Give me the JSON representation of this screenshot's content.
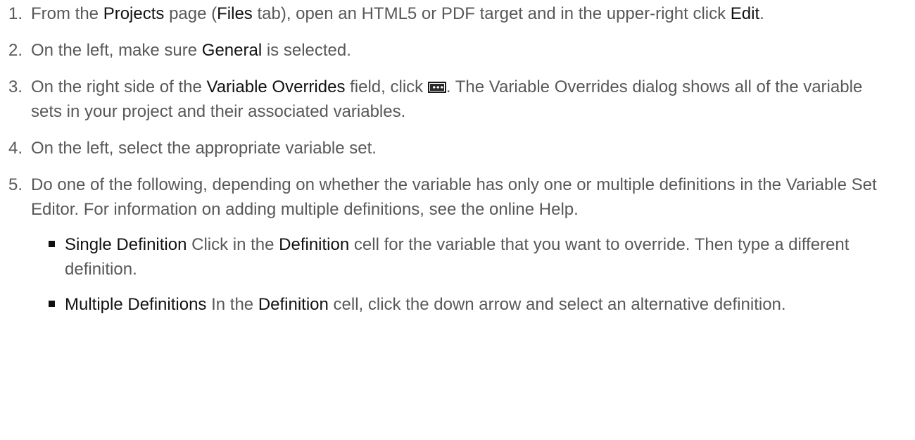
{
  "steps": [
    {
      "number": "1.",
      "parts": [
        {
          "t": "From the ",
          "b": false
        },
        {
          "t": "Projects",
          "b": true
        },
        {
          "t": " page (",
          "b": false
        },
        {
          "t": "Files",
          "b": true
        },
        {
          "t": " tab), open an HTML5 or PDF target and in the upper-right click ",
          "b": false
        },
        {
          "t": "Edit",
          "b": true
        },
        {
          "t": ".",
          "b": false
        }
      ]
    },
    {
      "number": "2.",
      "parts": [
        {
          "t": "On the left, make sure ",
          "b": false
        },
        {
          "t": "General",
          "b": true
        },
        {
          "t": " is selected.",
          "b": false
        }
      ]
    },
    {
      "number": "3.",
      "parts": [
        {
          "t": "On the right side of the ",
          "b": false
        },
        {
          "t": "Variable Overrides",
          "b": true
        },
        {
          "t": " field, click ",
          "b": false
        },
        {
          "icon": "ellipsis-button-icon"
        },
        {
          "t": ". The Variable Overrides dialog shows all of the variable sets in your project and their associated variables.",
          "b": false
        }
      ]
    },
    {
      "number": "4.",
      "parts": [
        {
          "t": "On the left, select the appropriate variable set.",
          "b": false
        }
      ]
    },
    {
      "number": "5.",
      "parts": [
        {
          "t": "Do one of the following, depending on whether the variable has only one or multiple definitions in the Variable Set Editor. For information on adding multiple definitions, see the online Help.",
          "b": false
        }
      ],
      "subitems": [
        {
          "parts": [
            {
              "t": "Single Definition",
              "b": true
            },
            {
              "t": " Click in the ",
              "b": false
            },
            {
              "t": "Definition",
              "b": true
            },
            {
              "t": " cell for the variable that you want to override. Then type a different definition.",
              "b": false
            }
          ]
        },
        {
          "parts": [
            {
              "t": "Multiple Definitions",
              "b": true
            },
            {
              "t": " In the ",
              "b": false
            },
            {
              "t": "Definition",
              "b": true
            },
            {
              "t": " cell, click the down arrow and select an alternative definition.",
              "b": false
            }
          ]
        }
      ]
    }
  ]
}
